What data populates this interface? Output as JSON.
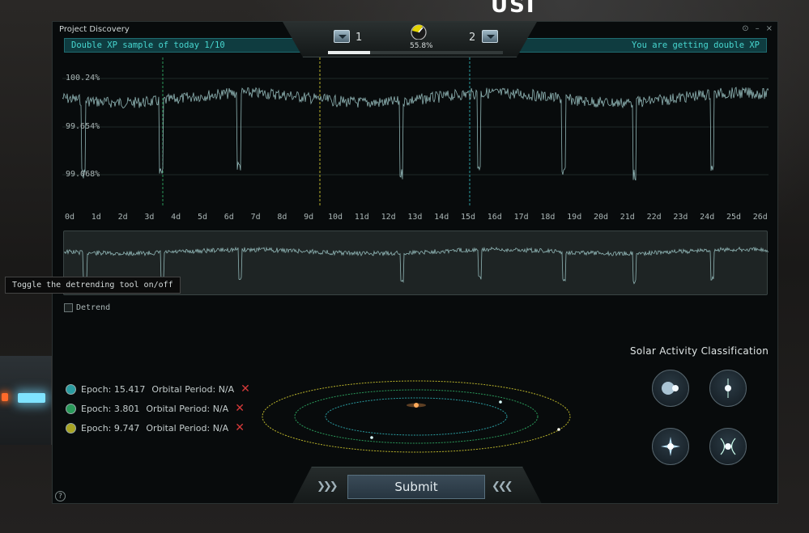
{
  "window": {
    "title": "Project Discovery"
  },
  "banner": {
    "left_text": "Double XP sample of today 1/10",
    "right_text": "You are getting double XP"
  },
  "header": {
    "left_count": "1",
    "right_count": "2",
    "percent": "55.8%",
    "xp_progress": 0.24
  },
  "chart": {
    "y_labels": [
      "100.24%",
      "99.654%",
      "99.068%"
    ],
    "x_ticks": [
      "0d",
      "1d",
      "2d",
      "3d",
      "4d",
      "5d",
      "6d",
      "7d",
      "8d",
      "9d",
      "10d",
      "11d",
      "12d",
      "13d",
      "14d",
      "15d",
      "16d",
      "17d",
      "18d",
      "19d",
      "20d",
      "21d",
      "22d",
      "23d",
      "24d",
      "25d",
      "26d"
    ]
  },
  "tooltip": {
    "text": "Toggle the detrending tool on/off"
  },
  "detrend": {
    "label": "Detrend"
  },
  "epochs": [
    {
      "epoch_label": "Epoch: 15.417",
      "period_label": "Orbital Period: N/A",
      "color": "#2a9ca0"
    },
    {
      "epoch_label": "Epoch: 3.801",
      "period_label": "Orbital Period: N/A",
      "color": "#2a9a5a"
    },
    {
      "epoch_label": "Epoch: 9.747",
      "period_label": "Orbital Period: N/A",
      "color": "#a8a423"
    }
  ],
  "classification": {
    "title": "Solar Activity Classification"
  },
  "submit": {
    "label": "Submit"
  },
  "colors": {
    "accent": "#47d7d0",
    "banner_bg": "#0f3c40",
    "submit_bg": "#334450"
  }
}
